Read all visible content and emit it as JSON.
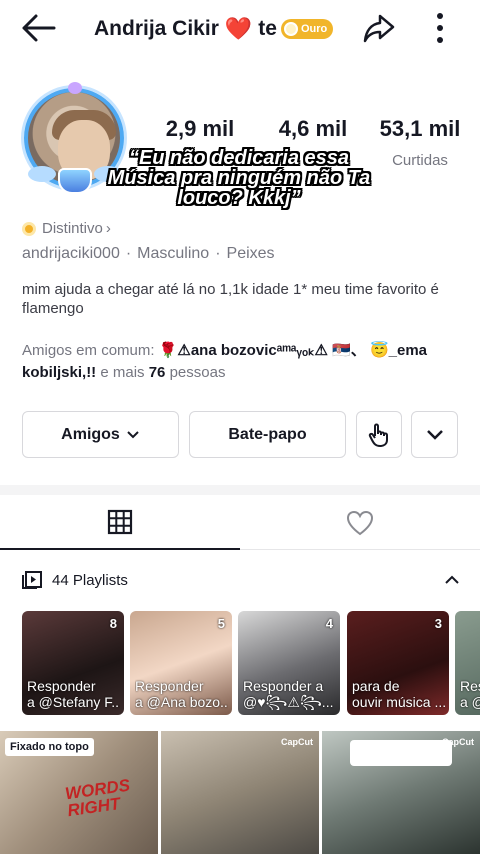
{
  "header": {
    "name": "Andrija Cikir",
    "heart": "❤️",
    "name_suffix": "te",
    "level_badge": "Ouro"
  },
  "stats": [
    {
      "value": "2,9 mil",
      "label": ""
    },
    {
      "value": "4,6 mil",
      "label": ""
    },
    {
      "value": "53,1 mil",
      "label": "Curtidas"
    }
  ],
  "overlay_text": "“Eu não dedicaria essa Música pra ninguém não Ta louco? Kkkj”",
  "profile": {
    "distintivo": "Distintivo",
    "username": "andrijaciki000",
    "gender": "Masculino",
    "sign": "Peixes",
    "bio": "mim ajuda a chegar até lá no 1,1k idade 1* meu time favorito é flamengo"
  },
  "friends": {
    "prefix": "Amigos em comum:",
    "friend1": "🌹⚠ana bozovicᵃᵐᵃᵧₒₖ⚠ 🇷🇸、",
    "friend2": "😇_ema kobiljski,!!",
    "middle": "e mais",
    "count": "76",
    "suffix": "pessoas"
  },
  "buttons": {
    "friends": "Amigos",
    "chat": "Bate-papo"
  },
  "playlists_header": "44 Playlists",
  "playlists": [
    {
      "count": "8",
      "caption1": "Responder",
      "caption2": "a @Stefany F..."
    },
    {
      "count": "5",
      "caption1": "Responder",
      "caption2": "a @Ana bozo..."
    },
    {
      "count": "4",
      "caption1": "Responder a",
      "caption2": "@♥꧂⚠꧂..."
    },
    {
      "count": "3",
      "caption1": "para de",
      "caption2": "ouvir música ..."
    },
    {
      "count": "",
      "caption1": "Res",
      "caption2": "a @"
    }
  ],
  "videos": [
    {
      "pinned_label": "Fixado no topo",
      "overlay": "WORDS RIGHT"
    },
    {
      "watermark": "CapCut"
    },
    {
      "watermark": "CapCut"
    }
  ],
  "colors": {
    "heart": "#e21b2c",
    "badge": "#f1b52a",
    "text": "#161823",
    "muted": "#757680"
  }
}
